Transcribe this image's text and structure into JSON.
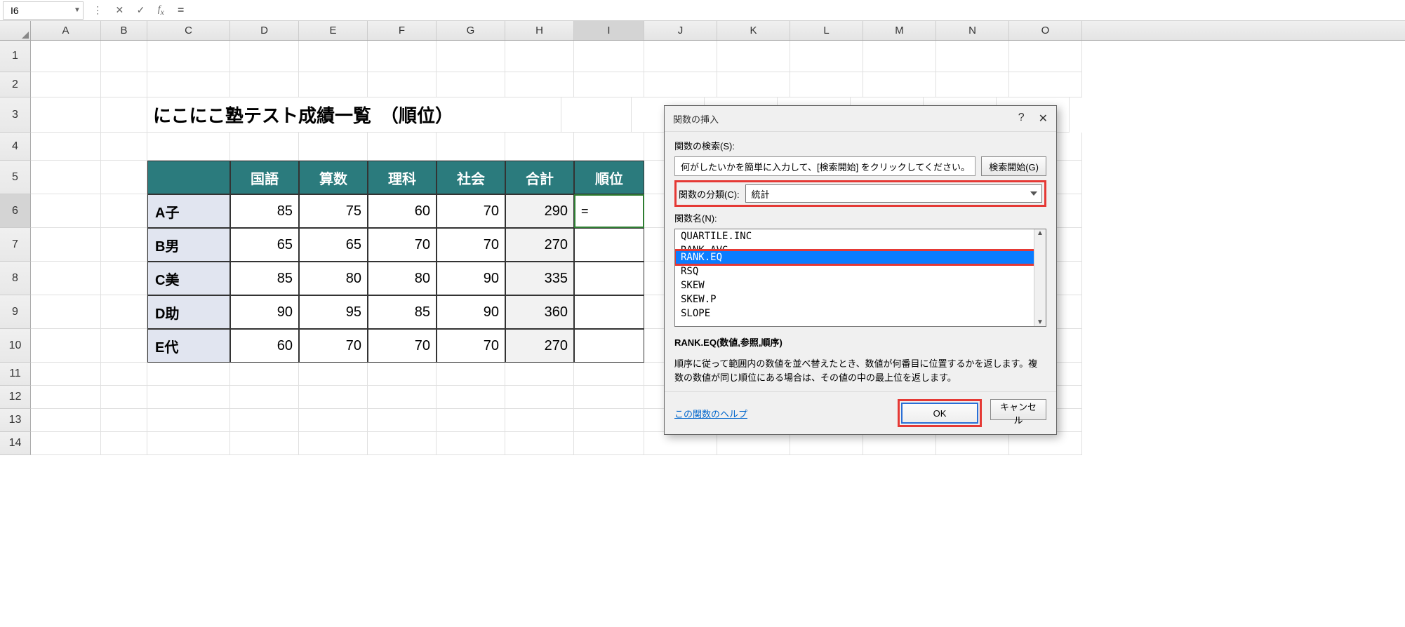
{
  "name_box": "I6",
  "formula_value": "=",
  "columns": [
    "A",
    "B",
    "C",
    "D",
    "E",
    "F",
    "G",
    "H",
    "I",
    "J",
    "K",
    "L",
    "M",
    "N",
    "O"
  ],
  "active_column": "I",
  "row_numbers": [
    1,
    2,
    3,
    4,
    5,
    6,
    7,
    8,
    9,
    10,
    11,
    12,
    13,
    14
  ],
  "active_row": 6,
  "sheet": {
    "title": "にこにこ塾テスト成績一覧　（順位）",
    "headers": [
      "",
      "国語",
      "算数",
      "理科",
      "社会",
      "合計",
      "順位"
    ],
    "rows": [
      {
        "name": "A子",
        "scores": [
          85,
          75,
          60,
          70
        ],
        "total": 290,
        "rank": "="
      },
      {
        "name": "B男",
        "scores": [
          65,
          65,
          70,
          70
        ],
        "total": 270,
        "rank": ""
      },
      {
        "name": "C美",
        "scores": [
          85,
          80,
          80,
          90
        ],
        "total": 335,
        "rank": ""
      },
      {
        "name": "D助",
        "scores": [
          90,
          95,
          85,
          90
        ],
        "total": 360,
        "rank": ""
      },
      {
        "name": "E代",
        "scores": [
          60,
          70,
          70,
          70
        ],
        "total": 270,
        "rank": ""
      }
    ]
  },
  "dialog": {
    "title": "関数の挿入",
    "search_label": "関数の検索(S):",
    "search_placeholder": "何がしたいかを簡単に入力して、[検索開始] をクリックしてください。",
    "search_btn": "検索開始(G)",
    "category_label": "関数の分類(C):",
    "category_value": "統計",
    "fn_label": "関数名(N):",
    "fn_items": [
      "QUARTILE.INC",
      "RANK.AVG",
      "RANK.EQ",
      "RSQ",
      "SKEW",
      "SKEW.P",
      "SLOPE"
    ],
    "fn_selected": "RANK.EQ",
    "fn_syntax": "RANK.EQ(数値,参照,順序)",
    "fn_desc": "順序に従って範囲内の数値を並べ替えたとき、数値が何番目に位置するかを返します。複数の数値が同じ順位にある場合は、その値の中の最上位を返します。",
    "help_link": "この関数のヘルプ",
    "ok": "OK",
    "cancel": "キャンセル"
  }
}
